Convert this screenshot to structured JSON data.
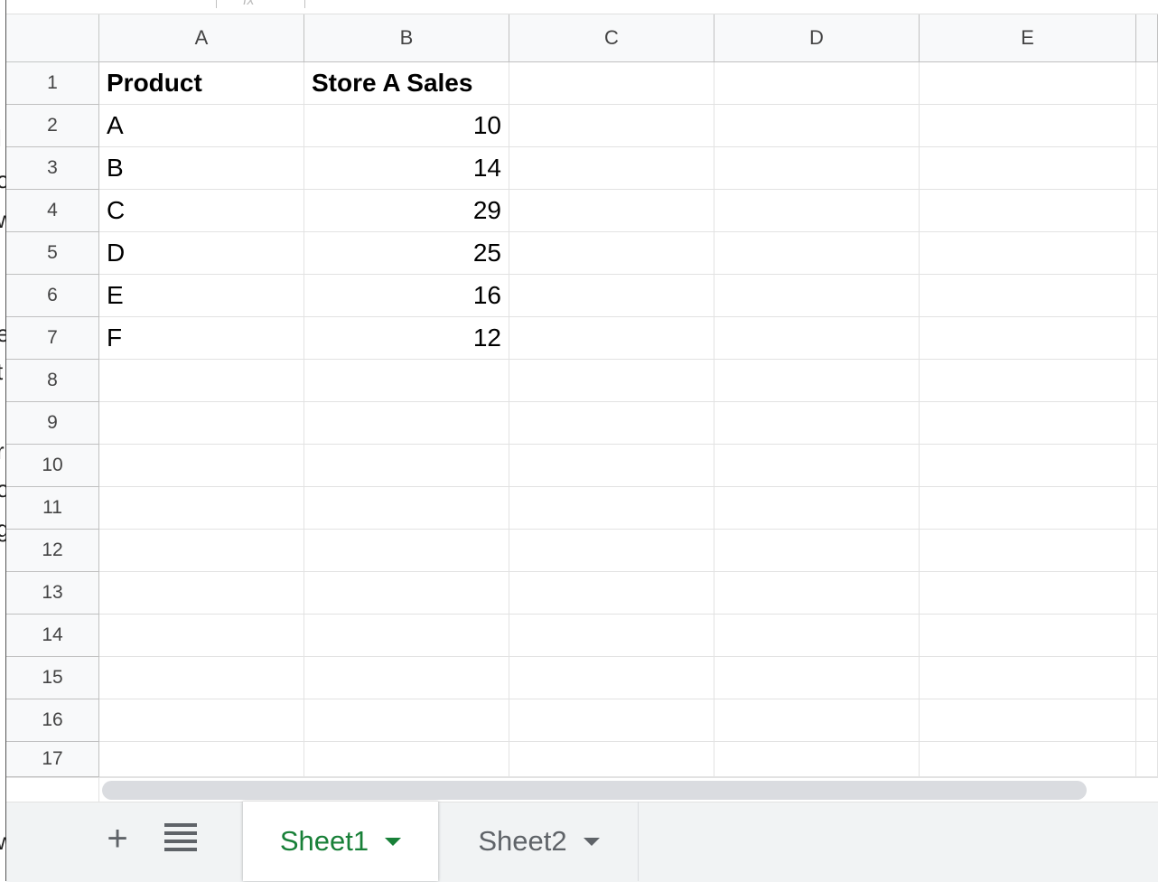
{
  "columns": [
    "A",
    "B",
    "C",
    "D",
    "E"
  ],
  "rows": [
    "1",
    "2",
    "3",
    "4",
    "5",
    "6",
    "7",
    "8",
    "9",
    "10",
    "11",
    "12",
    "13",
    "14",
    "15",
    "16",
    "17"
  ],
  "cells": {
    "A1": "Product",
    "B1": "Store A Sales",
    "A2": "A",
    "B2": "10",
    "A3": "B",
    "B3": "14",
    "A4": "C",
    "B4": "29",
    "A5": "D",
    "B5": "25",
    "A6": "E",
    "B6": "16",
    "A7": "F",
    "B7": "12"
  },
  "sheets": [
    {
      "label": "Sheet1",
      "active": true
    },
    {
      "label": "Sheet2",
      "active": false
    }
  ],
  "toolbar": {
    "add_sheet": "+"
  },
  "left_fragments": [
    "l",
    "o",
    "w",
    "e",
    "t",
    "r",
    "o",
    "g",
    "w"
  ],
  "formula_bar": {
    "fx": "fx"
  },
  "colors": {
    "active_tab": "#188038",
    "header_bg": "#f8f9fa",
    "tabbar_bg": "#f1f3f4"
  }
}
